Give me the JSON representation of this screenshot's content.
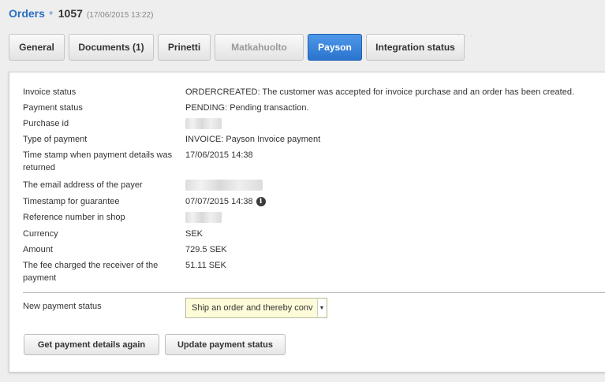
{
  "breadcrumb": {
    "orders_label": "Orders",
    "separator": "+",
    "order_number": "1057",
    "order_date": "(17/06/2015 13:22)"
  },
  "tabs": [
    {
      "label": "General",
      "state": "normal"
    },
    {
      "label": "Documents (1)",
      "state": "normal"
    },
    {
      "label": "Prinetti",
      "state": "normal"
    },
    {
      "label": "Matkahuolto",
      "state": "disabled"
    },
    {
      "label": "Payson",
      "state": "active"
    },
    {
      "label": "Integration status",
      "state": "normal"
    }
  ],
  "details": {
    "invoice_status": {
      "label": "Invoice status",
      "value": "ORDERCREATED: The customer was accepted for invoice purchase and an order has been created."
    },
    "payment_status": {
      "label": "Payment status",
      "value": "PENDING: Pending transaction."
    },
    "purchase_id": {
      "label": "Purchase id"
    },
    "type_of_payment": {
      "label": "Type of payment",
      "value": "INVOICE: Payson Invoice payment"
    },
    "timestamp_returned": {
      "label": "Time stamp when payment details was returned",
      "value": "17/06/2015 14:38"
    },
    "payer_email": {
      "label": "The email address of the payer"
    },
    "timestamp_guarantee": {
      "label": "Timestamp for guarantee",
      "value": "07/07/2015 14:38"
    },
    "reference_number": {
      "label": "Reference number in shop"
    },
    "currency": {
      "label": "Currency",
      "value": "SEK"
    },
    "amount": {
      "label": "Amount",
      "value": "729.5 SEK"
    },
    "fee": {
      "label": "The fee charged the receiver of the payment",
      "value": "51.11 SEK"
    }
  },
  "new_payment_status": {
    "label": "New payment status",
    "selected": "Ship an order and thereby conv"
  },
  "buttons": {
    "get_details": "Get payment details again",
    "update_status": "Update payment status"
  },
  "icons": {
    "info": "info-icon",
    "dropdown": "chevron-down-icon"
  },
  "colors": {
    "accent": "#2a74cf",
    "link": "#2a6fc1",
    "select_bg": "#fdfbd8"
  }
}
